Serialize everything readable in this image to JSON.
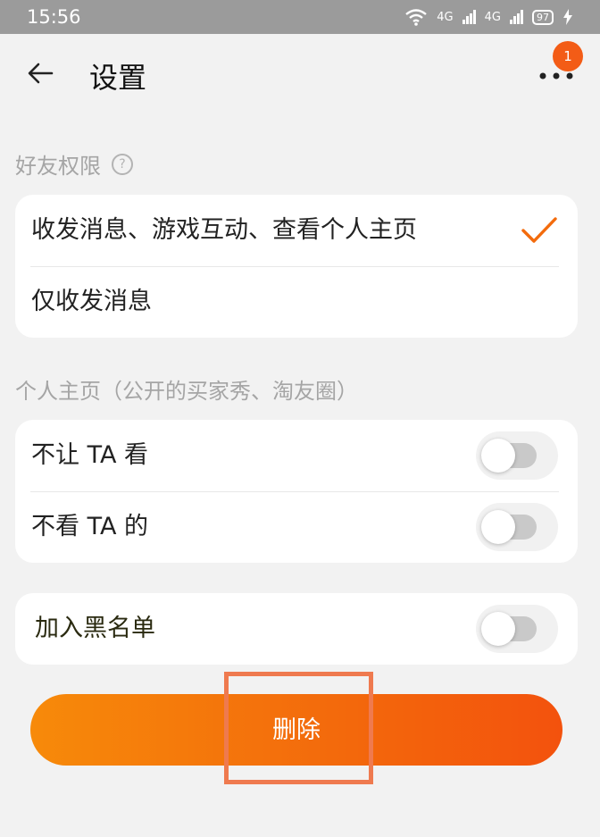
{
  "status_bar": {
    "time": "15:56",
    "net1": "4G",
    "net2": "4G",
    "battery": "97"
  },
  "header": {
    "title": "设置",
    "badge_count": "1"
  },
  "friend_permission": {
    "label": "好友权限",
    "help_glyph": "?",
    "options": [
      {
        "label": "收发消息、游戏互动、查看个人主页",
        "selected": true
      },
      {
        "label": "仅收发消息",
        "selected": false
      }
    ]
  },
  "profile_section": {
    "label": "个人主页（公开的买家秀、淘友圈）",
    "items": [
      {
        "label": "不让 TA 看",
        "on": false
      },
      {
        "label": "不看 TA 的",
        "on": false
      }
    ]
  },
  "blacklist": {
    "label": "加入黑名单",
    "on": false
  },
  "delete_button": {
    "label": "删除"
  },
  "colors": {
    "accent": "#f36b0c",
    "badge": "#f35c16",
    "highlight": "#ef7a4f"
  }
}
